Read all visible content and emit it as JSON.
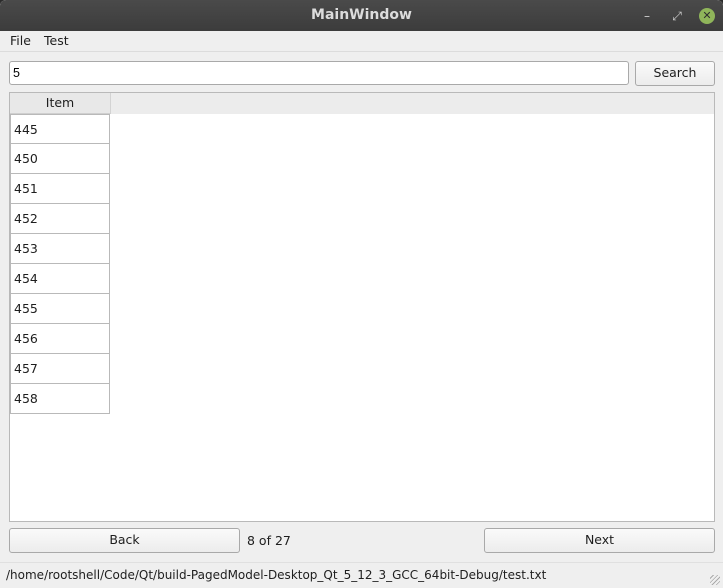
{
  "window": {
    "title": "MainWindow",
    "controls": {
      "minimize": "–",
      "maximize": "⤢",
      "close": "✕"
    }
  },
  "menu": [
    "File",
    "Test"
  ],
  "search": {
    "value": "5",
    "button": "Search"
  },
  "table": {
    "header": "Item",
    "rows": [
      "445",
      "450",
      "451",
      "452",
      "453",
      "454",
      "455",
      "456",
      "457",
      "458"
    ]
  },
  "nav": {
    "back": "Back",
    "page": "8 of 27",
    "next": "Next"
  },
  "status": {
    "path": "/home/rootshell/Code/Qt/build-PagedModel-Desktop_Qt_5_12_3_GCC_64bit-Debug/test.txt"
  },
  "icons": {
    "minimize": "minimize-icon",
    "maximize": "restore-icon",
    "close": "close-icon"
  },
  "colors": {
    "close_button": "#8fb55a",
    "titlebar": "#3c3c3c"
  }
}
